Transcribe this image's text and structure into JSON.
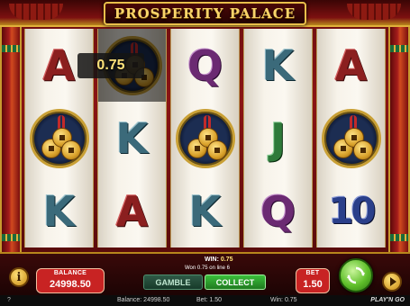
{
  "game": {
    "title": "PROSPERITY PALACE"
  },
  "reels": [
    [
      "A",
      "coins",
      "K"
    ],
    [
      "coins",
      "K",
      "A"
    ],
    [
      "Q",
      "coins",
      "K"
    ],
    [
      "K",
      "J",
      "Q"
    ],
    [
      "A",
      "coins",
      "10"
    ]
  ],
  "win_highlight": {
    "reel": 1,
    "row": 0,
    "amount": "0.75"
  },
  "controls": {
    "info_label": "i",
    "balance_label": "BALANCE",
    "balance_value": "24998.50",
    "win_label": "WIN:",
    "win_value": "0.75",
    "win_detail": "Won 0.75 on line 6",
    "gamble_label": "GAMBLE",
    "collect_label": "COLLECT",
    "bet_label": "BET",
    "bet_value": "1.50"
  },
  "status_bar": {
    "help_icon": "?",
    "balance": "Balance: 24998.50",
    "bet": "Bet: 1.50",
    "win": "Win: 0.75",
    "logo": "PLAY'N GO"
  }
}
